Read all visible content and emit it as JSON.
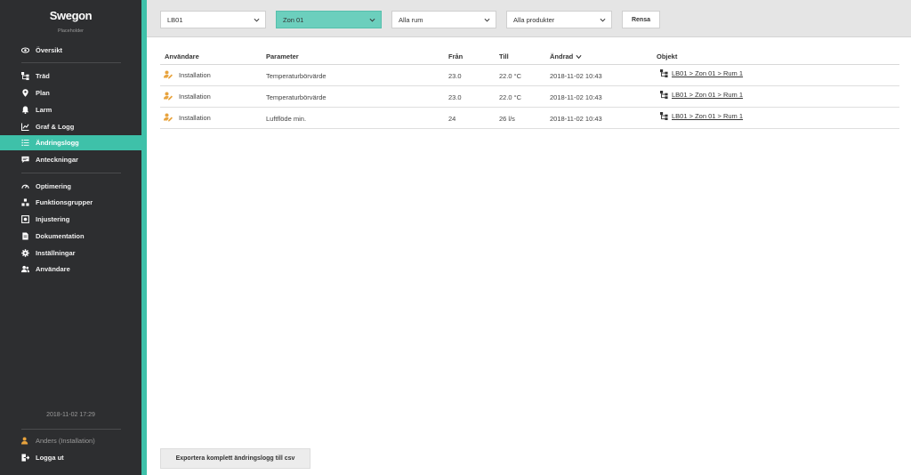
{
  "brand": {
    "logo": "Swegon",
    "subtitle": "Placeholder",
    "accent": "#3ec1a9",
    "sidebar_bg": "#2d2e30",
    "user_icon_color": "#e8a33d"
  },
  "nav": {
    "overview": "Översikt",
    "tree": "Träd",
    "plan": "Plan",
    "alarm": "Larm",
    "graph": "Graf & Logg",
    "changelog": "Ändringslogg",
    "notes": "Anteckningar",
    "optimization": "Optimering",
    "function_groups": "Funktionsgrupper",
    "balancing": "Injustering",
    "documentation": "Dokumentation",
    "settings": "Inställningar",
    "users": "Användare"
  },
  "sidebar_footer": {
    "datetime": "2018-11-02 17:29",
    "user": "Anders (Installation)",
    "logout": "Logga ut"
  },
  "filters": {
    "building": "LB01",
    "zone": "Zon 01",
    "rooms": "Alla rum",
    "products": "Alla produkter",
    "reset": "Rensa"
  },
  "table": {
    "headers": {
      "user": "Användare",
      "parameter": "Parameter",
      "from": "Från",
      "to": "Till",
      "changed": "Ändrad",
      "object": "Objekt"
    },
    "rows": [
      {
        "user": "Installation",
        "parameter": "Temperaturbörvärde",
        "from": "23.0",
        "to": "22.0 °C",
        "changed": "2018-11-02 10:43",
        "object": "LB01 > Zon 01 > Rum 1"
      },
      {
        "user": "Installation",
        "parameter": "Temperaturbörvärde",
        "from": "23.0",
        "to": "22.0 °C",
        "changed": "2018-11-02 10:43",
        "object": "LB01 > Zon 01 > Rum 1"
      },
      {
        "user": "Installation",
        "parameter": "Luftflöde min.",
        "from": "24",
        "to": "26 l/s",
        "changed": "2018-11-02 10:43",
        "object": "LB01 > Zon 01 > Rum 1"
      }
    ]
  },
  "export_label": "Exportera komplett ändringslogg till csv"
}
